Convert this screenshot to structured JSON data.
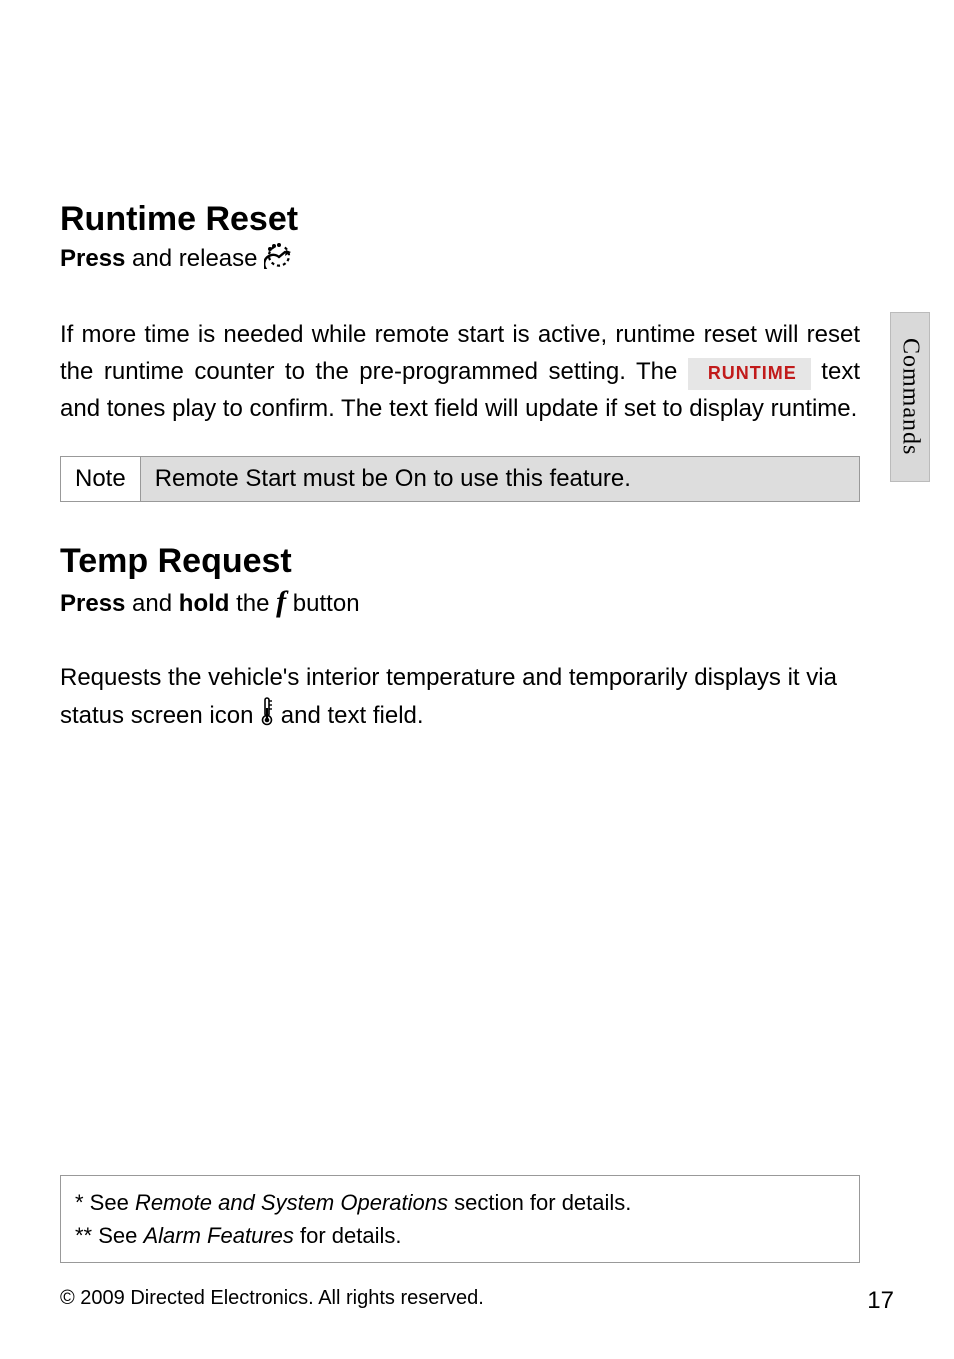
{
  "sideTab": "Commands",
  "section1": {
    "title": "Runtime Reset",
    "instruct_prefix_bold": "Press",
    "instruct_mid": " and release ",
    "para_part1": "If more time is needed while remote start is active, runtime reset will reset the runtime counter to the pre-programmed setting. The ",
    "badge": "RUNTIME",
    "para_part2": " text and tones play to confirm. The text field will update if set to display runtime."
  },
  "note": {
    "label": "Note",
    "text": "Remote Start must be On to use this feature."
  },
  "section2": {
    "title": "Temp Request",
    "instruct_prefix_bold": "Press",
    "instruct_mid": " and ",
    "instruct_hold": "hold",
    "instruct_after": " the ",
    "instruct_btn": "f",
    "instruct_end": " button",
    "para_part1": "Requests the vehicle's interior temperature and temporarily displays it via status screen icon ",
    "para_part2": " and text field."
  },
  "footnotes": {
    "l1_prefix": "*  See ",
    "l1_ref": "Remote and System Operations",
    "l1_suffix": " section for details.",
    "l2_prefix": "** See ",
    "l2_ref": "Alarm Features",
    "l2_suffix": " for details."
  },
  "footer": {
    "copyright": "© 2009 Directed Electronics. All rights reserved.",
    "page": "17"
  }
}
